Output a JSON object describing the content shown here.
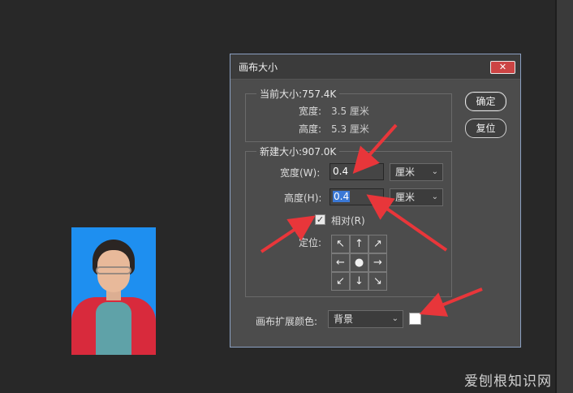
{
  "dialog": {
    "title": "画布大小",
    "close_symbol": "✕",
    "current_size": {
      "label": "当前大小:757.4K",
      "width_label": "宽度:",
      "width_value": "3.5 厘米",
      "height_label": "高度:",
      "height_value": "5.3 厘米"
    },
    "new_size": {
      "label": "新建大小:907.0K",
      "width_label": "宽度(W):",
      "width_value": "0.4",
      "width_unit": "厘米",
      "height_label": "高度(H):",
      "height_value": "0.4",
      "height_unit": "厘米",
      "relative_label": "相对(R)",
      "relative_checked": true,
      "anchor_label": "定位:",
      "anchor_arrows": [
        "↖",
        "↑",
        "↗",
        "←",
        "●",
        "→",
        "↙",
        "↓",
        "↘"
      ]
    },
    "buttons": {
      "ok": "确定",
      "reset": "复位"
    },
    "extension": {
      "label": "画布扩展颜色:",
      "value": "背景",
      "swatch_color": "#ffffff"
    }
  },
  "watermark": "爱刨根知识网",
  "colors": {
    "annotation_arrow": "#e8363a",
    "selection": "#3a78d6"
  }
}
